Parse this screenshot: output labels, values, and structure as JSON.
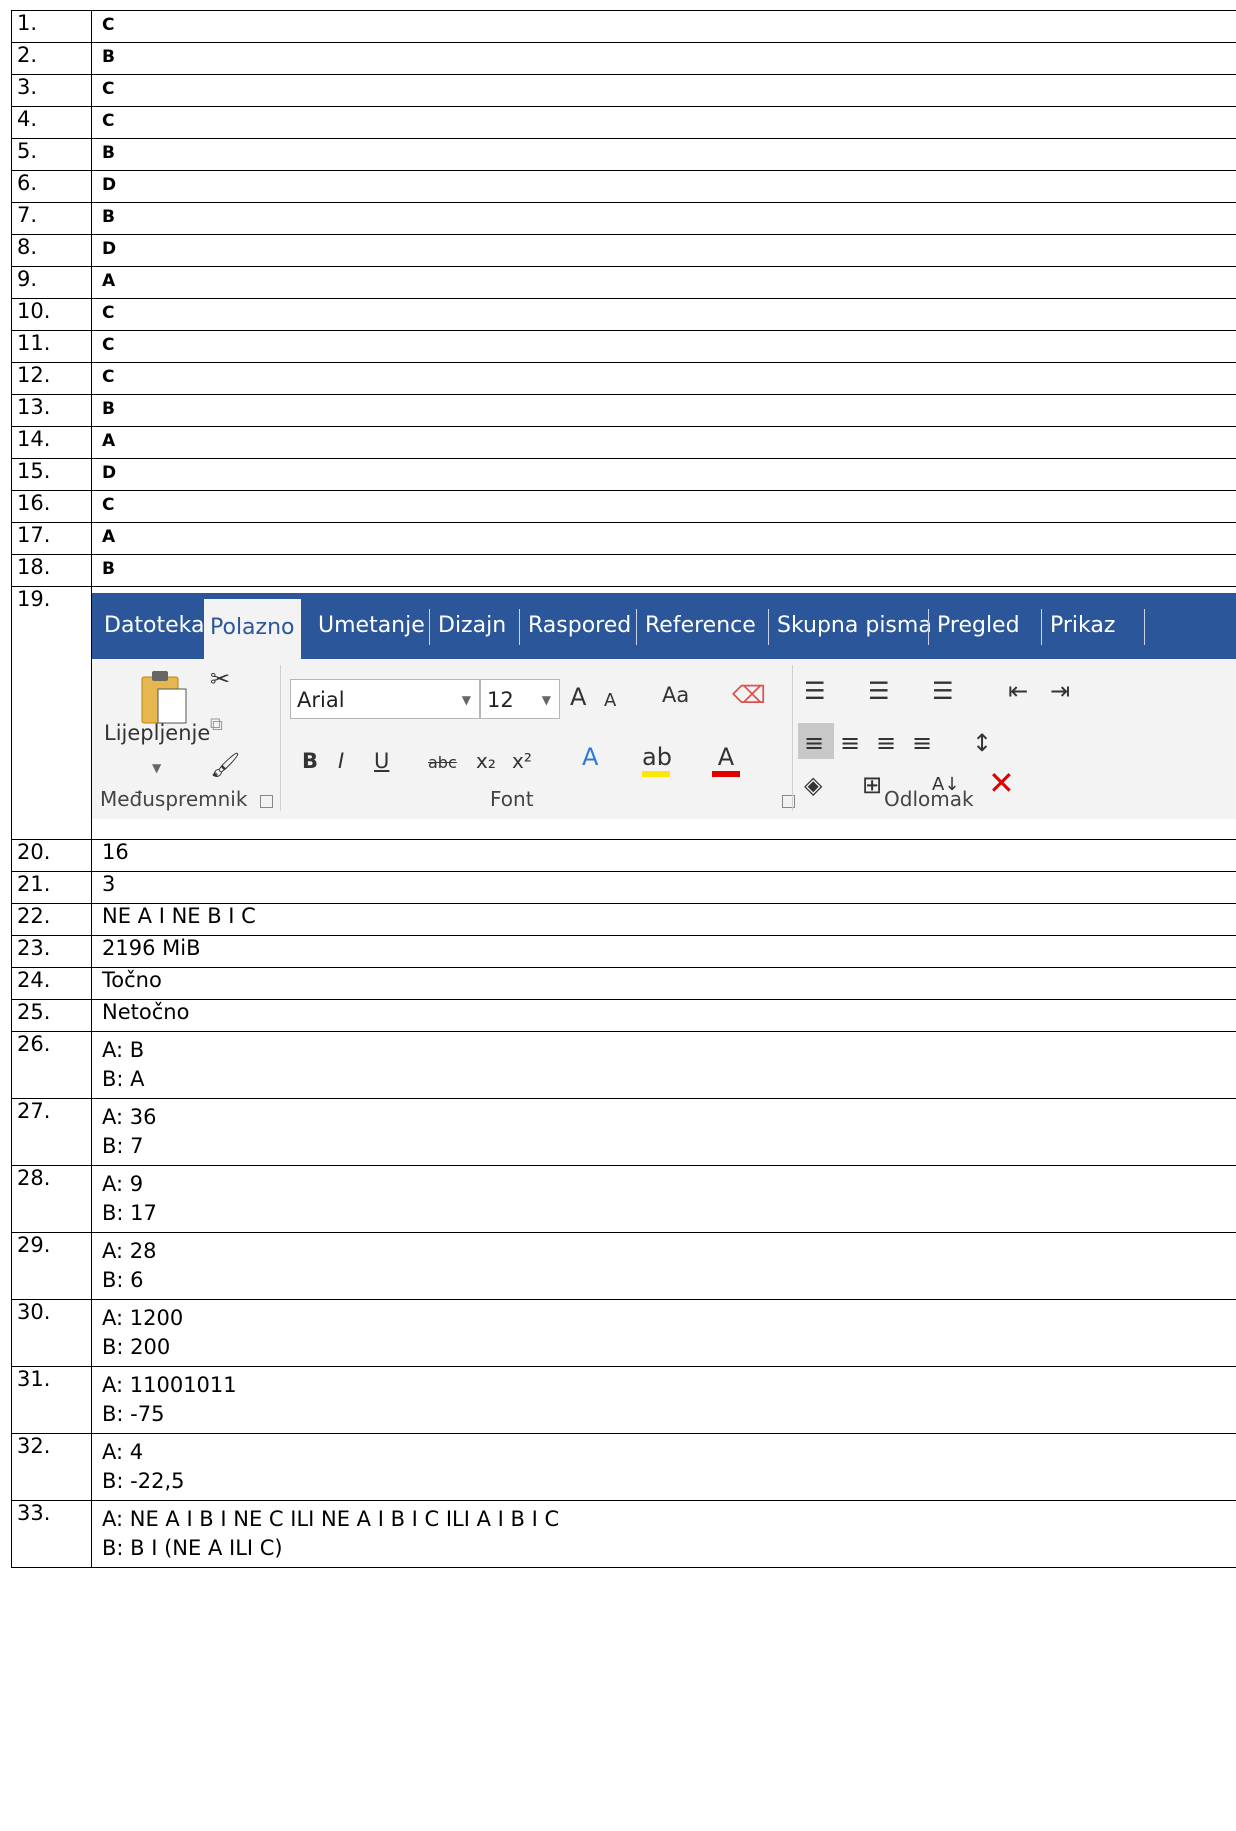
{
  "rows": [
    {
      "n": "1.",
      "a": "C",
      "bold": true
    },
    {
      "n": "2.",
      "a": "B",
      "bold": true
    },
    {
      "n": "3.",
      "a": "C",
      "bold": true
    },
    {
      "n": "4.",
      "a": "C",
      "bold": true
    },
    {
      "n": "5.",
      "a": "B",
      "bold": true
    },
    {
      "n": "6.",
      "a": "D",
      "bold": true
    },
    {
      "n": "7.",
      "a": "B",
      "bold": true
    },
    {
      "n": "8.",
      "a": "D",
      "bold": true
    },
    {
      "n": "9.",
      "a": "A",
      "bold": true
    },
    {
      "n": "10.",
      "a": "C",
      "bold": true
    },
    {
      "n": "11.",
      "a": "C",
      "bold": true
    },
    {
      "n": "12.",
      "a": "C",
      "bold": true
    },
    {
      "n": "13.",
      "a": "B",
      "bold": true
    },
    {
      "n": "14.",
      "a": "A",
      "bold": true
    },
    {
      "n": "15.",
      "a": "D",
      "bold": true
    },
    {
      "n": "16.",
      "a": "C",
      "bold": true
    },
    {
      "n": "17.",
      "a": "A",
      "bold": true
    },
    {
      "n": "18.",
      "a": "B",
      "bold": true
    }
  ],
  "ribbon_row": {
    "n": "19.",
    "tabs": [
      "Datoteka",
      "Polazno",
      "Umetanje",
      "Dizajn",
      "Raspored",
      "Reference",
      "Skupna pisma",
      "Pregled",
      "Prikaz"
    ],
    "active_tab": "Polazno",
    "paste_label": "Lijepljenje",
    "font_name": "Arial",
    "font_size": "12",
    "group_clipboard": "Međuspremnik",
    "group_font": "Font",
    "group_paragraph": "Odlomak"
  },
  "rows2": [
    {
      "n": "20.",
      "a": "16"
    },
    {
      "n": "21.",
      "a": "3"
    },
    {
      "n": "22.",
      "a": "NE A I NE B I C"
    },
    {
      "n": "23.",
      "a": "2196 MiB"
    },
    {
      "n": "24.",
      "a": "Točno"
    },
    {
      "n": "25.",
      "a": "Netočno"
    }
  ],
  "pairs": [
    {
      "n": "26.",
      "a": "A: B",
      "b": "B: A"
    },
    {
      "n": "27.",
      "a": "A: 36",
      "b": "B: 7"
    },
    {
      "n": "28.",
      "a": "A: 9",
      "b": "B: 17"
    },
    {
      "n": "29.",
      "a": "A: 28",
      "b": "B: 6"
    },
    {
      "n": "30.",
      "a": "A: 1200",
      "b": "B: 200"
    },
    {
      "n": "31.",
      "a": "A: 11001011",
      "b": "B: -75"
    },
    {
      "n": "32.",
      "a": "A: 4",
      "b": "B: -22,5"
    },
    {
      "n": "33.",
      "a": "A: NE A I B I NE C ILI NE A I B I C ILI A I B I C",
      "b": "B: B I (NE A ILI C)"
    }
  ]
}
